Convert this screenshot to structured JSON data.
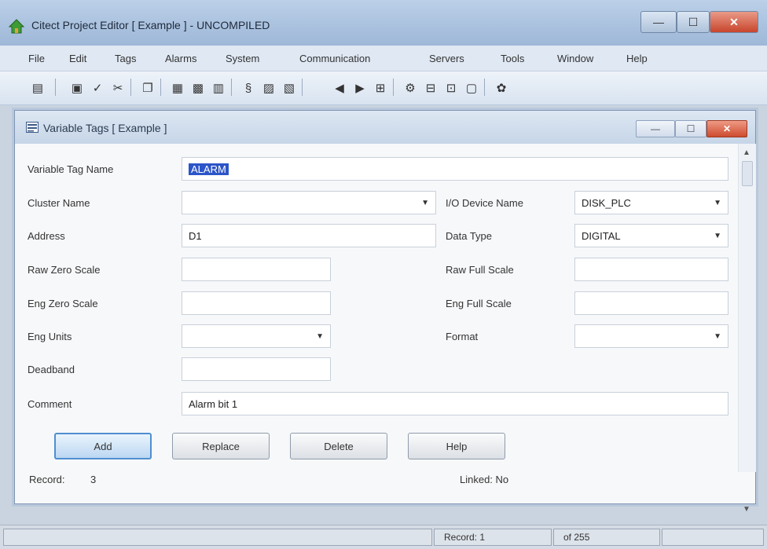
{
  "window": {
    "title": "Citect Project Editor [ Example ] - UNCOMPILED",
    "minimize_glyph": "—",
    "maximize_glyph": "☐",
    "close_glyph": "✕"
  },
  "menu": [
    "File",
    "Edit",
    "Tags",
    "Alarms",
    "System",
    "Communication",
    "Servers",
    "Tools",
    "Window",
    "Help"
  ],
  "toolbar_icons": [
    "project-icon",
    "save-icon",
    "compile-icon",
    "cut-icon",
    "copy-icon",
    "paste-icon",
    "variable-tags-icon",
    "advanced-alarms-icon",
    "digital-alarms-icon",
    "analog-alarms-icon",
    "prev-record-icon",
    "next-record-icon",
    "add-record-icon",
    "express-wizard-icon",
    "devices-icon",
    "ports-icon",
    "boards-icon",
    "help-icon"
  ],
  "child": {
    "title": "Variable Tags [ Example ]",
    "minimize_glyph": "—",
    "maximize_glyph": "☐",
    "close_glyph": "✕"
  },
  "form": {
    "tag_name_label": "Variable Tag Name",
    "tag_name_value": "ALARM",
    "cluster_label": "Cluster Name",
    "cluster_value": "",
    "io_device_label": "I/O Device Name",
    "io_device_value": "DISK_PLC",
    "address_label": "Address",
    "address_value": "D1",
    "data_type_label": "Data Type",
    "data_type_value": "DIGITAL",
    "raw_zero_label": "Raw Zero Scale",
    "raw_zero_value": "",
    "raw_full_label": "Raw Full Scale",
    "raw_full_value": "",
    "eng_zero_label": "Eng Zero Scale",
    "eng_zero_value": "",
    "eng_full_label": "Eng Full Scale",
    "eng_full_value": "",
    "eng_units_label": "Eng Units",
    "eng_units_value": "",
    "format_label": "Format",
    "format_value": "",
    "deadband_label": "Deadband",
    "deadband_value": "",
    "comment_label": "Comment",
    "comment_value": "Alarm bit 1",
    "buttons": {
      "add": "Add",
      "replace": "Replace",
      "delete": "Delete",
      "help": "Help"
    },
    "record_label": "Record:",
    "record_value": "3",
    "linked_label": "Linked: No"
  },
  "status": {
    "record": "Record: 1",
    "of": "of 255"
  }
}
